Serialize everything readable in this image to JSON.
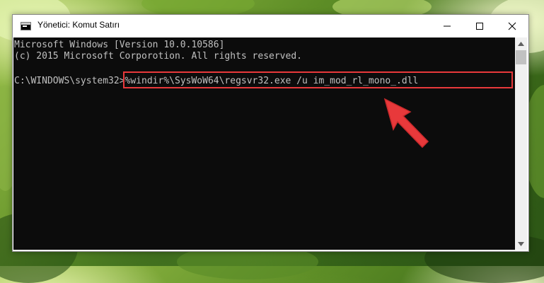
{
  "window": {
    "title": "Yönetici: Komut Satırı",
    "controls": {
      "minimize": "minimize",
      "maximize": "maximize",
      "close": "close"
    }
  },
  "console": {
    "lines": [
      "Microsoft Windows [Version 10.0.10586]",
      "(c) 2015 Microsoft Corporotion. All rights reserved."
    ],
    "prompt": "C:\\WINDOWS\\system32>",
    "command": "%windir%\\SysWoW64\\regsvr32.exe /u im_mod_rl_mono_.dll"
  },
  "colors": {
    "highlight": "#e8393b",
    "console_bg": "#0c0c0c",
    "console_text": "#c0c0c0"
  }
}
